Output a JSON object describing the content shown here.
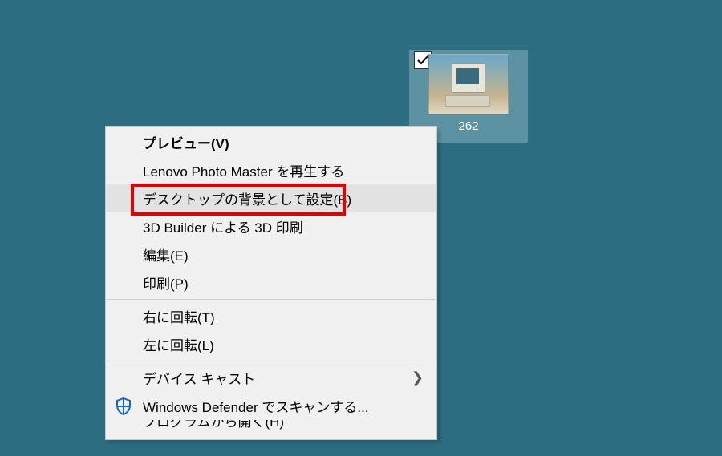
{
  "desktop": {
    "icon_label": "262",
    "checked": true
  },
  "context_menu": {
    "items": [
      {
        "label": "プレビュー(V)",
        "bold": true
      },
      {
        "label": "Lenovo Photo Master を再生する"
      },
      {
        "label": "デスクトップの背景として設定(B)",
        "highlighted": true,
        "hover": true
      },
      {
        "label": "3D Builder による 3D 印刷"
      },
      {
        "label": "編集(E)"
      },
      {
        "label": "印刷(P)"
      },
      {
        "sep": true
      },
      {
        "label": "右に回転(T)"
      },
      {
        "label": "左に回転(L)"
      },
      {
        "sep": true
      },
      {
        "label": "デバイス キャスト",
        "submenu": true
      },
      {
        "label": "Windows Defender でスキャンする...",
        "icon": "defender"
      },
      {
        "label": "プログラムから開く(H)",
        "submenu": true,
        "cutoff": true
      }
    ]
  },
  "colors": {
    "desktop_bg": "#2d6d81",
    "menu_bg": "#f0f0f0",
    "highlight_red": "#e20000"
  }
}
